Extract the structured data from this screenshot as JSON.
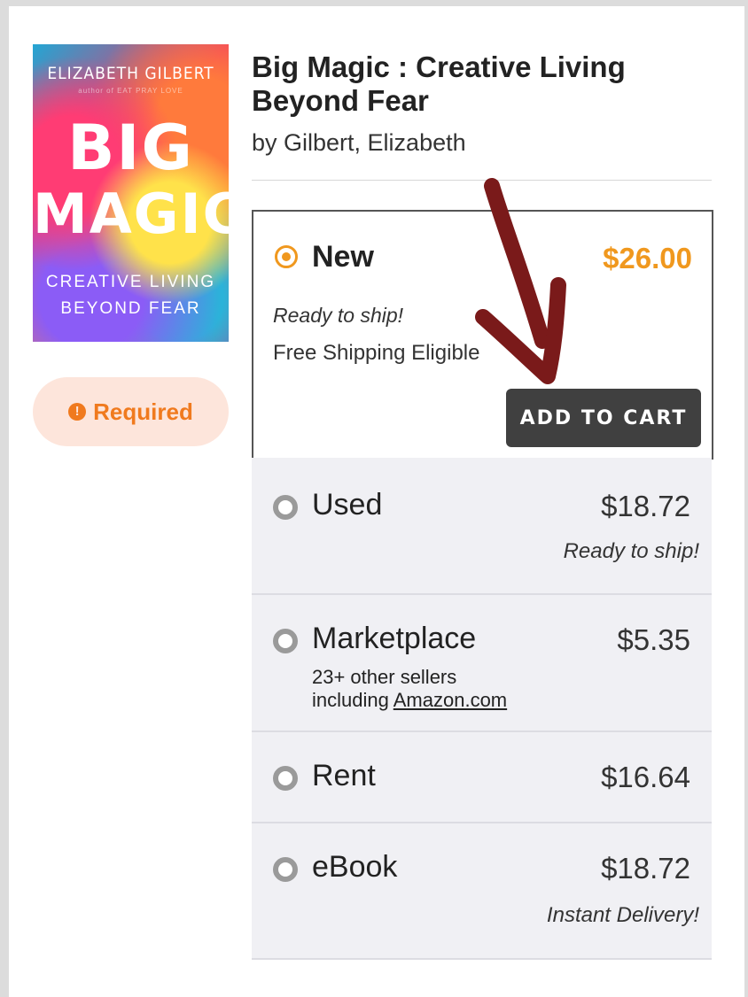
{
  "product": {
    "cover": {
      "author": "ELIZABETH GILBERT",
      "small_line": "author of EAT PRAY LOVE",
      "title_line1": "BIG",
      "title_line2": "MAGIC",
      "subtitle_line1": "CREATIVE LIVING",
      "subtitle_line2": "BEYOND FEAR"
    },
    "title": "Big Magic : Creative Living Beyond Fear",
    "byline": "by Gilbert, Elizabeth",
    "required_label": "Required"
  },
  "new_option": {
    "label": "New",
    "price": "$26.00",
    "ready": "Ready to ship!",
    "shipping": "Free Shipping Eligible",
    "button": "ADD TO CART"
  },
  "options": {
    "used": {
      "label": "Used",
      "price": "$18.72",
      "note": "Ready to ship!"
    },
    "marketplace": {
      "label": "Marketplace",
      "price": "$5.35",
      "sub_line1": "23+ other sellers",
      "sub_line2_prefix": "including",
      "sub_link": "Amazon.com"
    },
    "rent": {
      "label": "Rent",
      "price": "$16.64"
    },
    "ebook": {
      "label": "eBook",
      "price": "$18.72",
      "note": "Instant Delivery!"
    }
  },
  "colors": {
    "accent": "#f0981e",
    "button": "#404040",
    "arrow": "#7a1a1a",
    "required_bg": "#fde5db"
  }
}
